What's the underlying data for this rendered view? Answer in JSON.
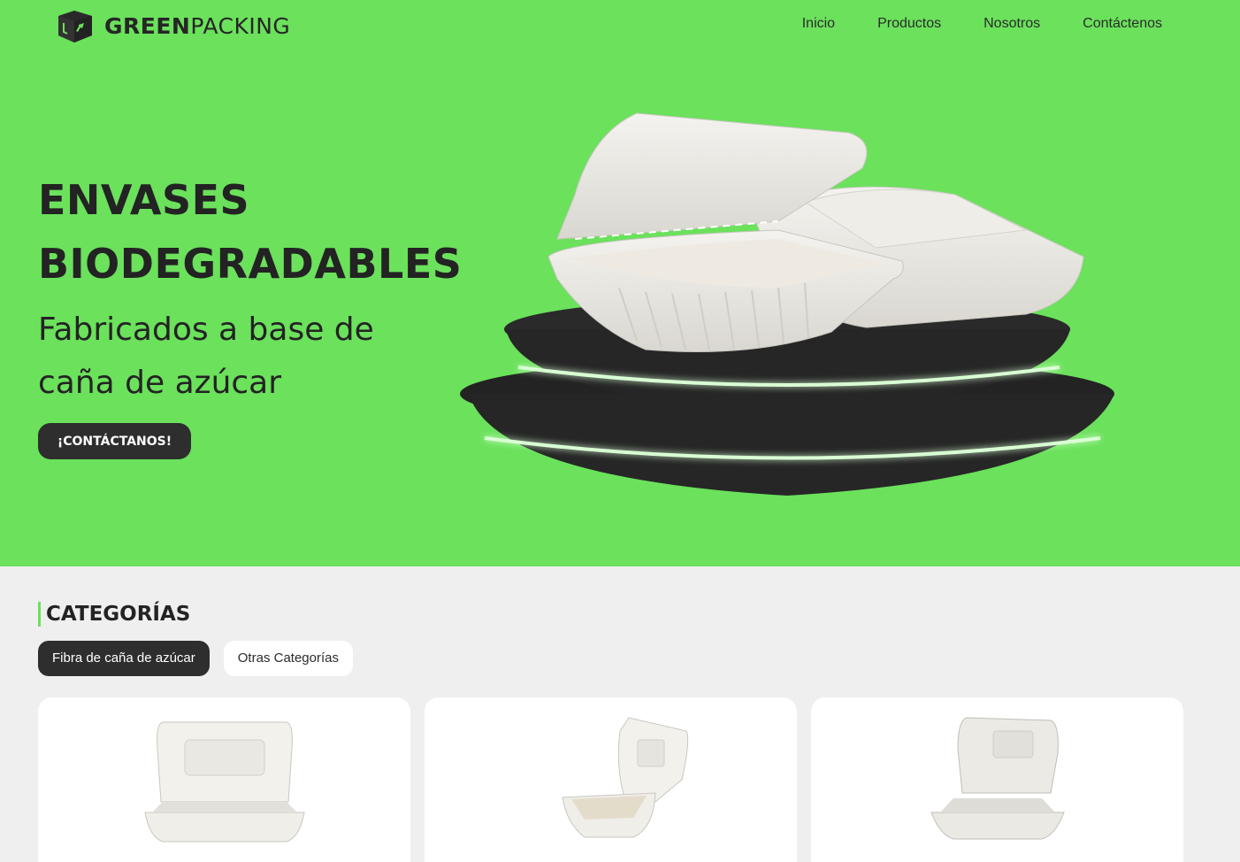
{
  "header": {
    "logo": {
      "part1": "GREEN",
      "part2": "PACKING",
      "icon": "box-recycle-logo-icon"
    },
    "nav": [
      {
        "label": "Inicio"
      },
      {
        "label": "Productos"
      },
      {
        "label": "Nosotros"
      },
      {
        "label": "Contáctenos"
      }
    ]
  },
  "hero": {
    "title_line1": "ENVASES",
    "title_line2": "BIODEGRADABLES",
    "subtitle": "Fabricados a base de caña de azúcar",
    "cta_label": "¡CONTÁCTANOS!",
    "background_color": "#6be15c",
    "image": "biodegradable-containers-on-podium"
  },
  "categories": {
    "title": "CATEGORÍAS",
    "tabs": [
      {
        "label": "Fibra de caña de azúcar",
        "active": true
      },
      {
        "label": "Otras Categorías",
        "active": false
      }
    ],
    "products": [
      {
        "image": "rectangular-clamshell-container"
      },
      {
        "image": "square-clamshell-container"
      },
      {
        "image": "hinged-container-open"
      }
    ]
  }
}
